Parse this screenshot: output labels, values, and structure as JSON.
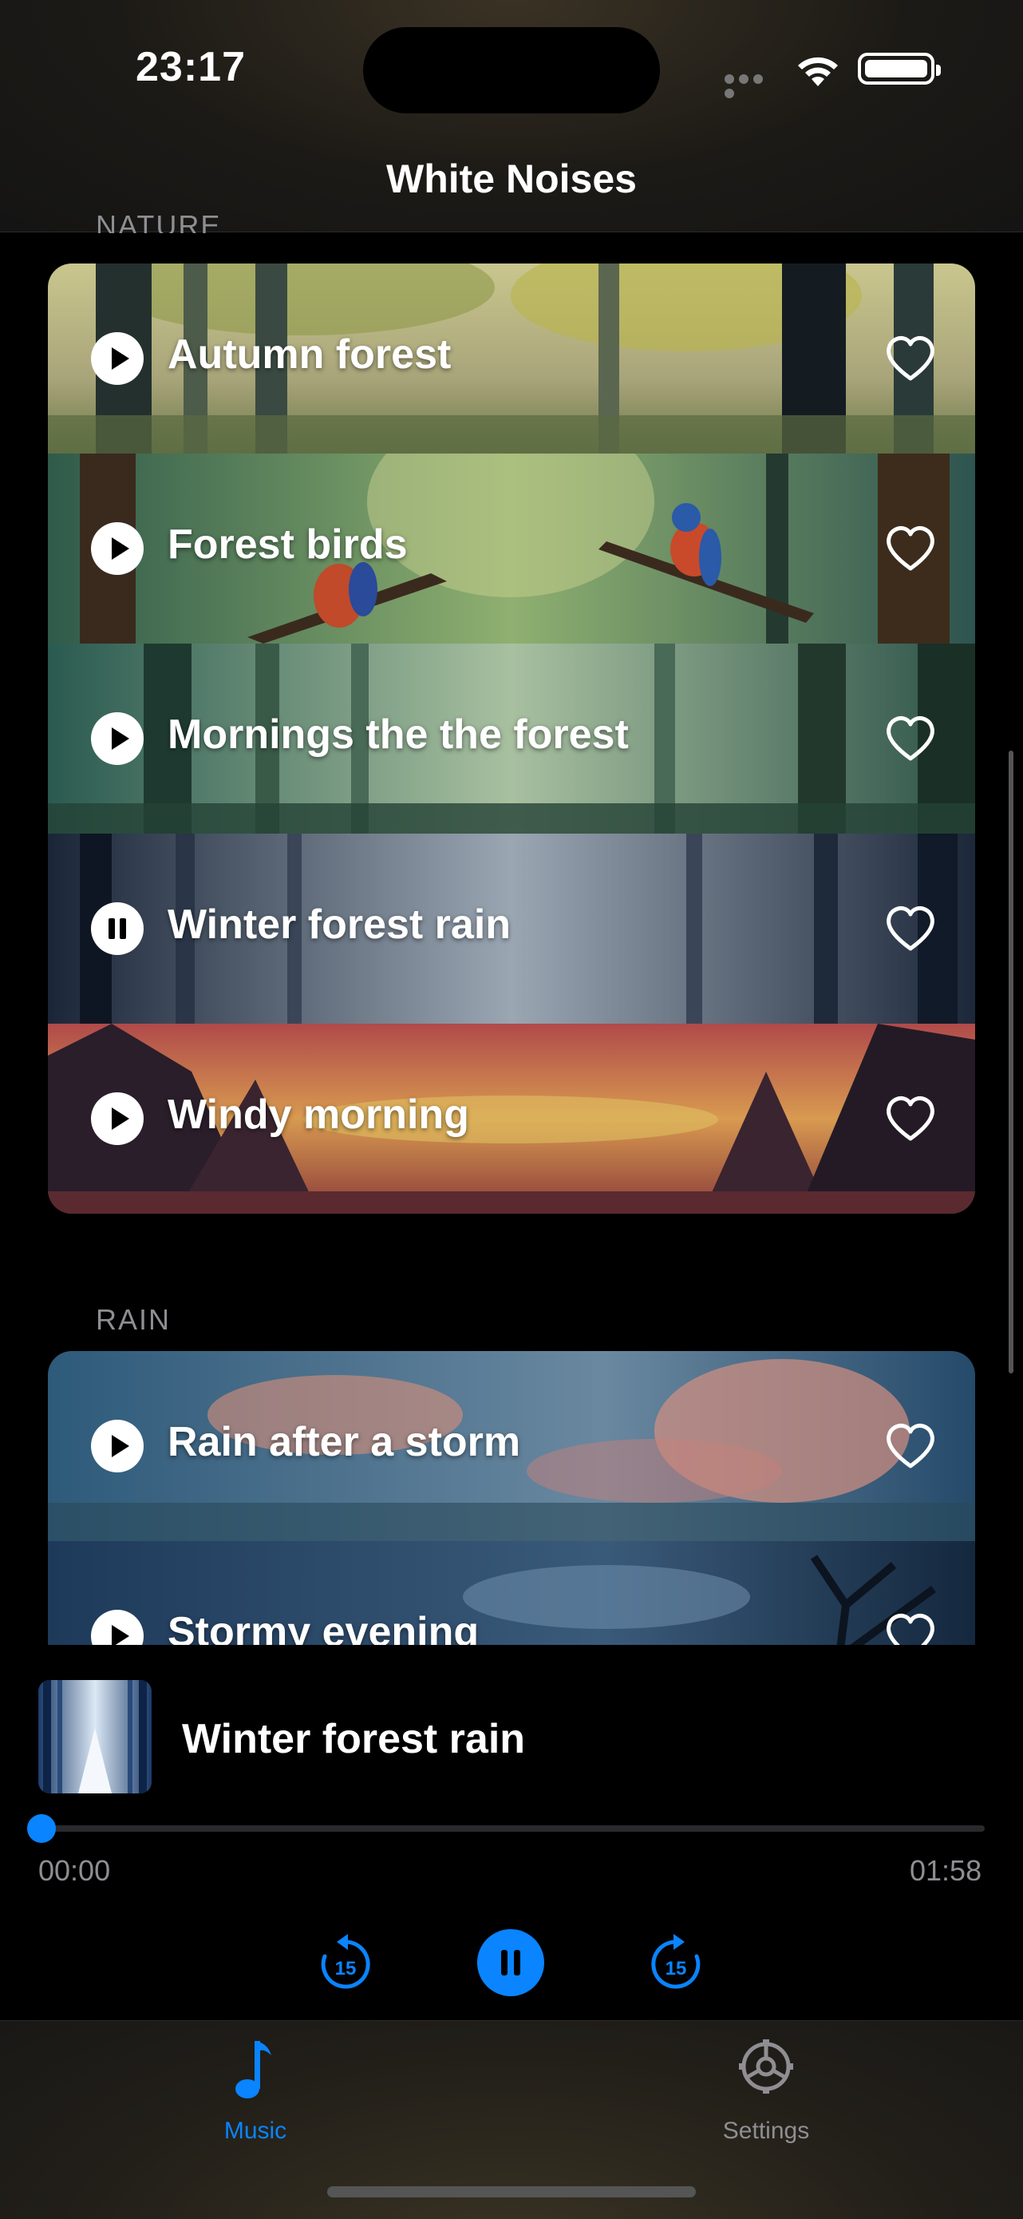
{
  "status_bar": {
    "time": "23:17"
  },
  "header": {
    "title": "White Noises"
  },
  "sections": [
    {
      "label": "NATURE",
      "items": [
        {
          "name": "Autumn forest",
          "state": "play",
          "bg": "autumn"
        },
        {
          "name": "Forest birds",
          "state": "play",
          "bg": "birds"
        },
        {
          "name": "Mornings the the forest",
          "state": "play",
          "bg": "morning"
        },
        {
          "name": "Winter forest rain",
          "state": "pause",
          "bg": "winter"
        },
        {
          "name": "Windy morning",
          "state": "play",
          "bg": "windy"
        }
      ]
    },
    {
      "label": "RAIN",
      "items": [
        {
          "name": "Rain after a storm",
          "state": "play",
          "bg": "storm"
        },
        {
          "name": "Stormy evening",
          "state": "play",
          "bg": "evening"
        }
      ]
    }
  ],
  "player": {
    "title": "Winter forest rain",
    "elapsed": "00:00",
    "duration": "01:58",
    "progress": 0,
    "rewind_label": "15",
    "forward_label": "15"
  },
  "tabs": [
    {
      "label": "Music",
      "icon": "music-note-icon",
      "active": true
    },
    {
      "label": "Settings",
      "icon": "gear-icon",
      "active": false
    }
  ],
  "colors": {
    "accent": "#0a84ff",
    "inactive": "#8e8e93"
  }
}
